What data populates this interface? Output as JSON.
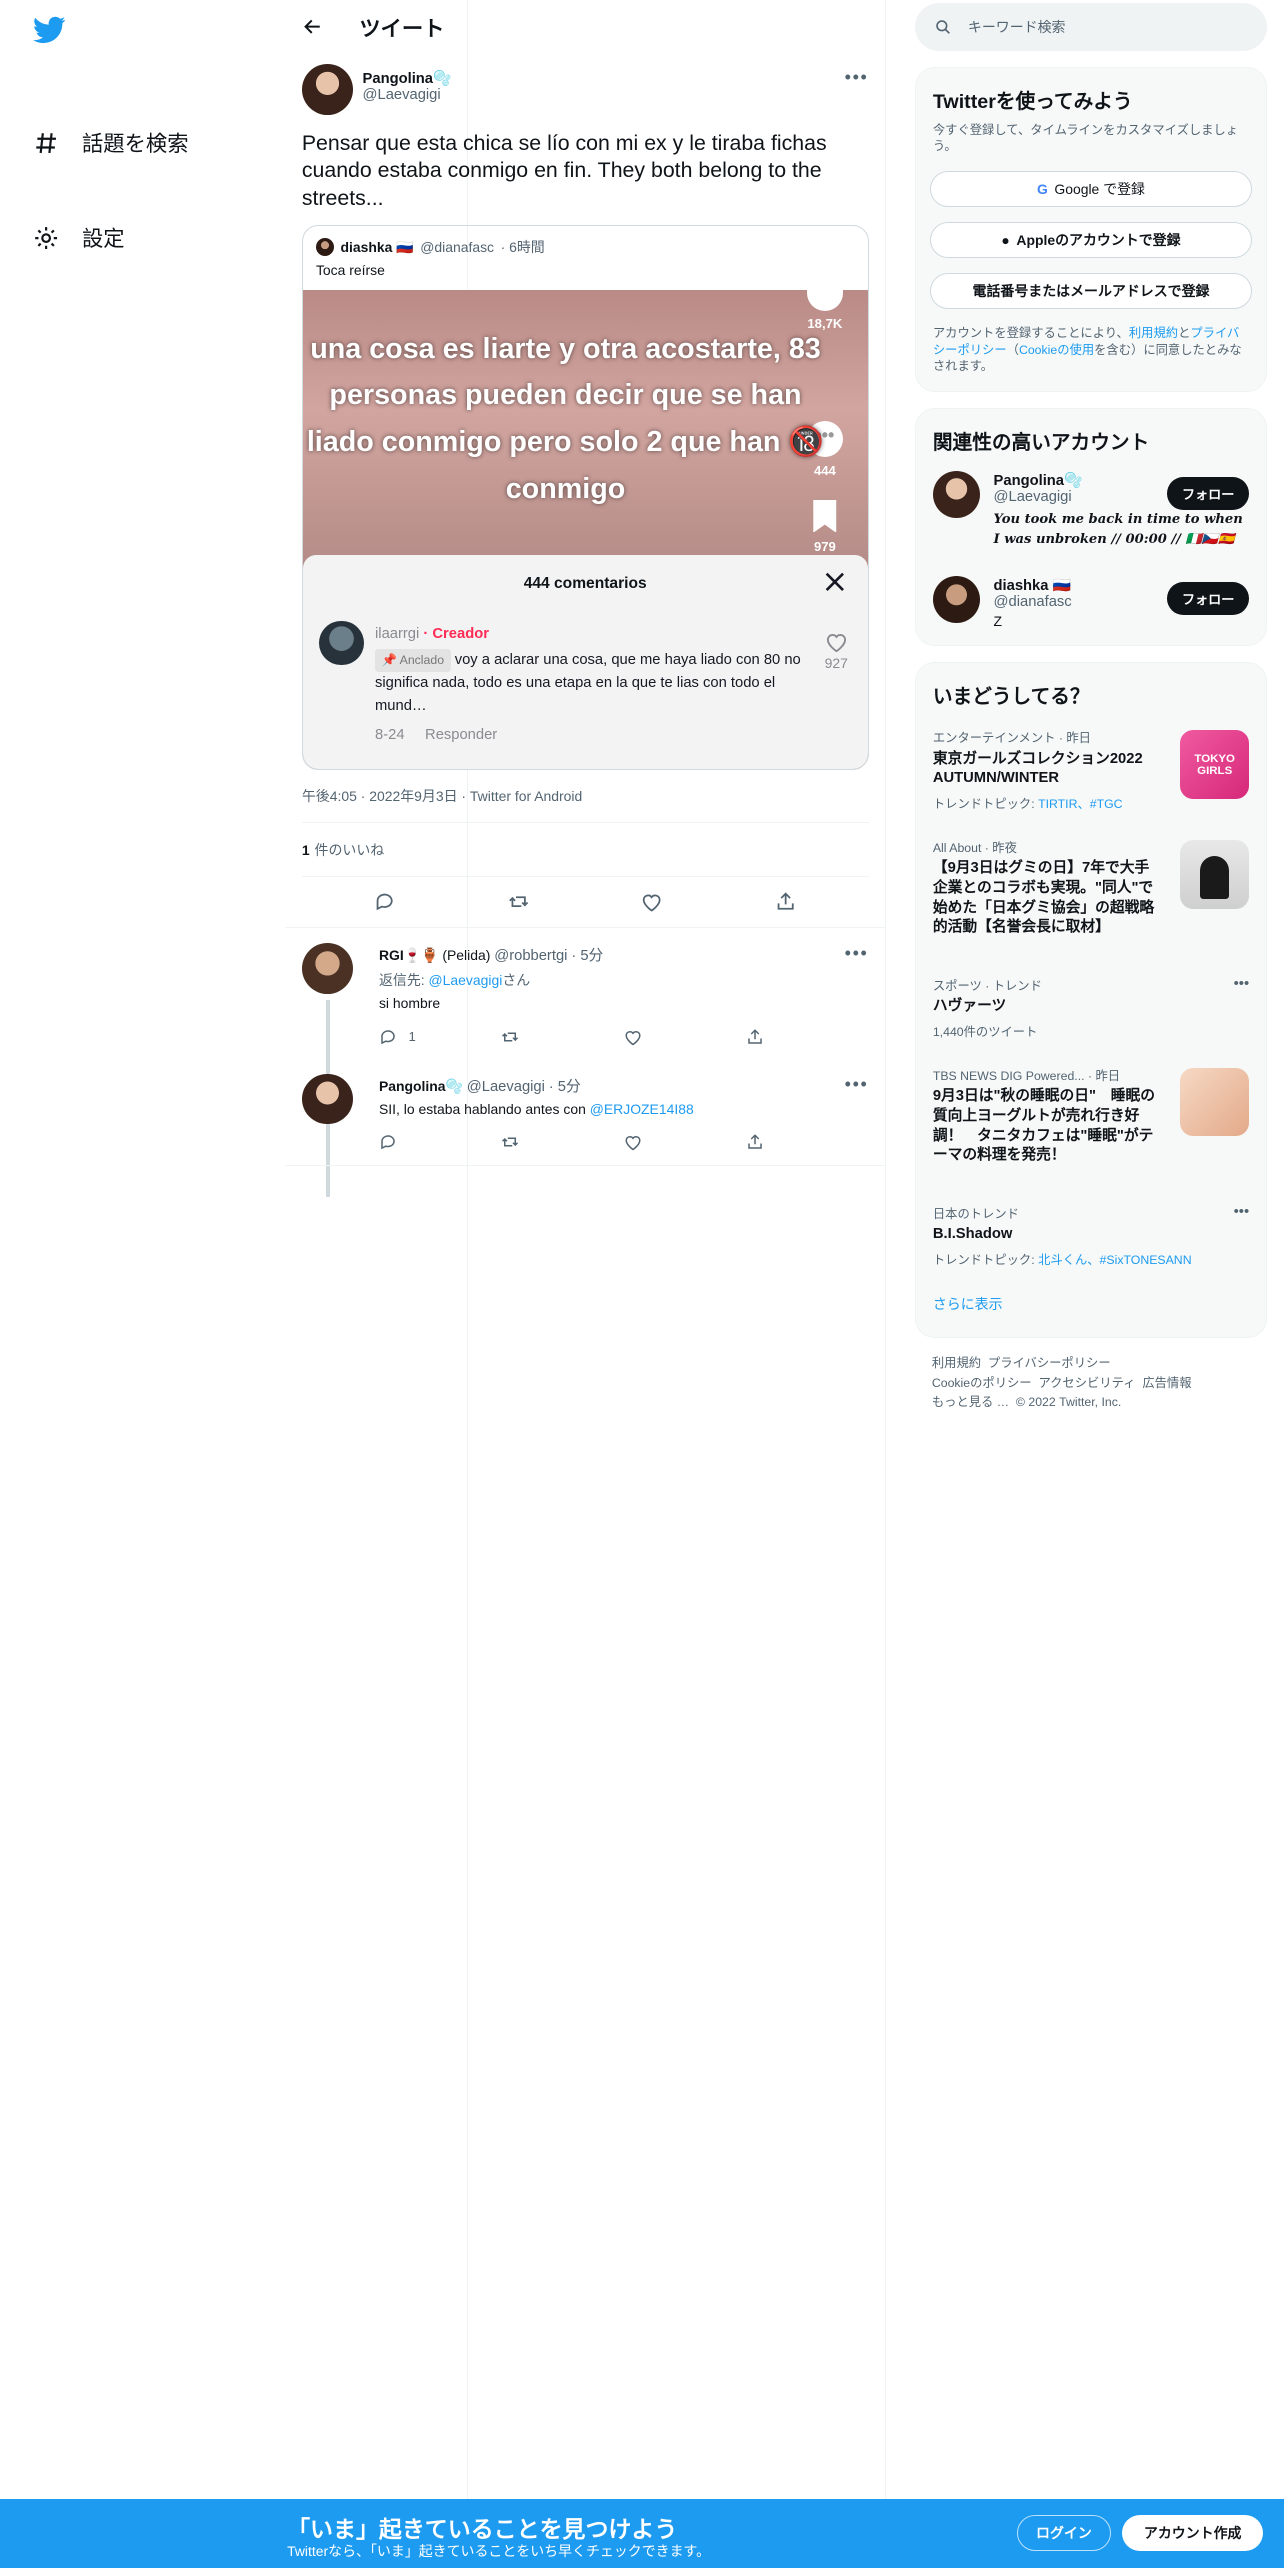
{
  "colors": {
    "brand": "#1d9bf0",
    "text": "#0f1419",
    "secondary": "#536471",
    "creator": "#fe2c55"
  },
  "nav": {
    "explore": "話題を検索",
    "settings": "設定"
  },
  "header": {
    "title": "ツイート"
  },
  "tweet": {
    "name": "Pangolina🫧",
    "handle": "@Laevagigi",
    "text": "Pensar que esta chica se lío con mi ex y le tiraba fichas cuando estaba conmigo en fin. They both belong to the streets...",
    "meta": "午後4:05 · 2022年9月3日 · Twitter for Android",
    "likes_count": "1",
    "likes_label": "件のいいね"
  },
  "quote": {
    "name": "diashka 🇷🇺",
    "handle": "@dianafasc",
    "time": "· 6時間",
    "text": "Toca reírse",
    "caption": "una cosa es liarte y otra acostarte, 83 personas pueden decir que se han liado conmigo pero solo 2 que han 🔞 conmigo",
    "likes": "18,7K",
    "comments": "444",
    "saves": "979",
    "sheet_title": "444 comentarios",
    "commenter": "ilaarrgi",
    "creator_label": "· Creador",
    "pinned": "📌 Anclado",
    "comment": "voy a aclarar una cosa, que me haya liado con 80 no significa nada, todo es una etapa en la que te lias con todo el mund…",
    "comment_date": "8-24",
    "reply_label": "Responder",
    "comment_likes": "927"
  },
  "replies": [
    {
      "name": "RGI🍷🏺",
      "extra": "(Pelida)",
      "handle": "@robbertgi",
      "time": "· 5分",
      "reply_to_prefix": "返信先: ",
      "reply_to": "@Laevagigi",
      "reply_to_suffix": "さん",
      "text": "si hombre",
      "reply_count": "1"
    },
    {
      "name": "Pangolina🫧",
      "handle": "@Laevagigi",
      "time": "· 5分",
      "text_prefix": "SII, lo estaba hablando antes con ",
      "mention": "@ERJOZE14I88"
    }
  ],
  "search": {
    "placeholder": "キーワード検索"
  },
  "signup_card": {
    "title": "Twitterを使ってみよう",
    "subtitle": "今すぐ登録して、タイムラインをカスタマイズしましょう。",
    "google": "Google で登録",
    "apple": "Appleのアカウントで登録",
    "phone": "電話番号またはメールアドレスで登録",
    "note_prefix": "アカウントを登録することにより、",
    "terms": "利用規約",
    "and": "と",
    "privacy": "プライバシーポリシー",
    "cookie_open": "（",
    "cookie": "Cookieの使用",
    "note_suffix": "を含む）に同意したとみなされます。"
  },
  "related": {
    "title": "関連性の高いアカウント",
    "accounts": [
      {
        "name": "Pangolina🫧",
        "handle": "@Laevagigi",
        "bio": "You took me back in time to when I was unbroken // 00:00 // 🇮🇹🇨🇿🇪🇸",
        "follow": "フォロー"
      },
      {
        "name": "diashka 🇷🇺",
        "handle": "@dianafasc",
        "bio": "Z",
        "follow": "フォロー"
      }
    ]
  },
  "trends": {
    "title": "いまどうしてる？",
    "items": [
      {
        "category": "エンターテインメント · 昨日",
        "title": "東京ガールズコレクション2022 AUTUMN/WINTER",
        "sub_prefix": "トレンドトピック: ",
        "topics": "TIRTIR、#TGC",
        "image_label": "TOKYO GIRLS"
      },
      {
        "category": "All About · 昨夜",
        "title": "【9月3日はグミの日】7年で大手企業とのコラボも実現。\"同人\"で始めた「日本グミ協会」の超戦略的活動【名誉会長に取材】"
      },
      {
        "category": "スポーツ · トレンド",
        "title": "ハヴァーツ",
        "sub": "1,440件のツイート"
      },
      {
        "category": "TBS NEWS DIG Powered... · 昨日",
        "title": "9月3日は\"秋の睡眠の日\"　睡眠の質向上ヨーグルトが売れ行き好調！　タニタカフェは\"睡眠\"がテーマの料理を発売！"
      },
      {
        "category": "日本のトレンド",
        "title": "B.I.Shadow",
        "sub_prefix": "トレンドトピック: ",
        "topics": "北斗くん、#SixTONESANN"
      }
    ],
    "show_more": "さらに表示"
  },
  "footer": {
    "terms": "利用規約",
    "privacy": "プライバシーポリシー",
    "cookie": "Cookieのポリシー",
    "accessibility": "アクセシビリティ",
    "ads": "広告情報",
    "more": "もっと見る …",
    "copyright": "© 2022 Twitter, Inc."
  },
  "banner": {
    "title": "「いま」起きていることを見つけよう",
    "subtitle": "Twitterなら、「いま」起きていることをいち早くチェックできます。",
    "login": "ログイン",
    "signup": "アカウント作成"
  }
}
